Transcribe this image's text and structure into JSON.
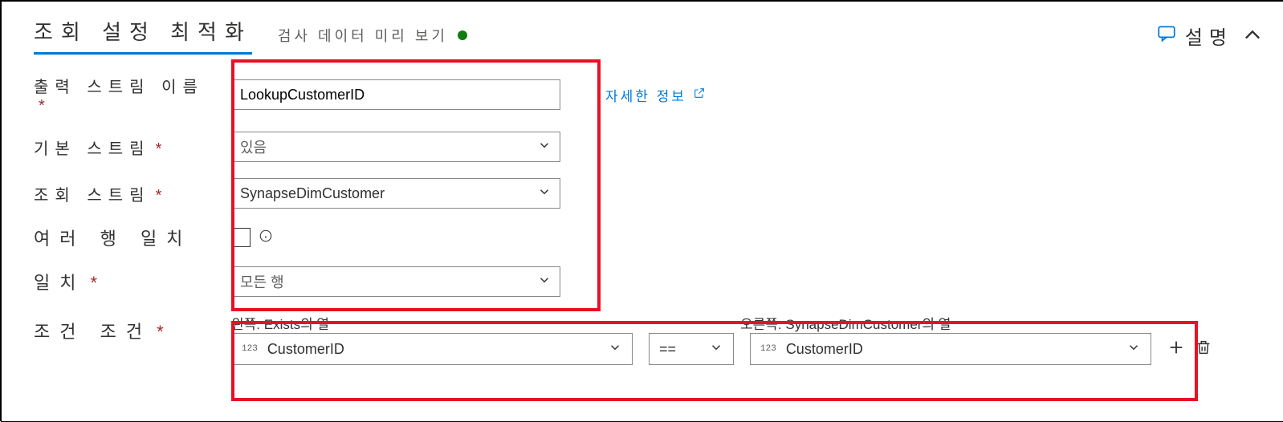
{
  "tabs": {
    "main": "조회 설정 최적화",
    "preview_label": "검사 데이터 미리 보기"
  },
  "header_right": {
    "comment_label": "설명"
  },
  "fields": {
    "output_stream_label": "출력 스트림 이름",
    "output_stream_value": "LookupCustomerID",
    "learn_more": "자세한 정보",
    "primary_stream_label": "기본 스트림",
    "primary_stream_value": "있음",
    "lookup_stream_label": "조회 스트림",
    "lookup_stream_value": "SynapseDimCustomer",
    "multi_row_match_label": "여러 행 일치",
    "match_label": "일치",
    "match_value": "모든 행",
    "conditions_label": "조건 조건"
  },
  "conditions": {
    "left_header_prefix": "왼쪽: ",
    "left_header_source": "Exists의 열",
    "right_header_prefix": "오른쪽: ",
    "right_header_source": "SynapseDimCustomer의 열",
    "left_type": "123",
    "left_value": "CustomerID",
    "operator": "==",
    "right_type": "123",
    "right_value": "CustomerID"
  }
}
